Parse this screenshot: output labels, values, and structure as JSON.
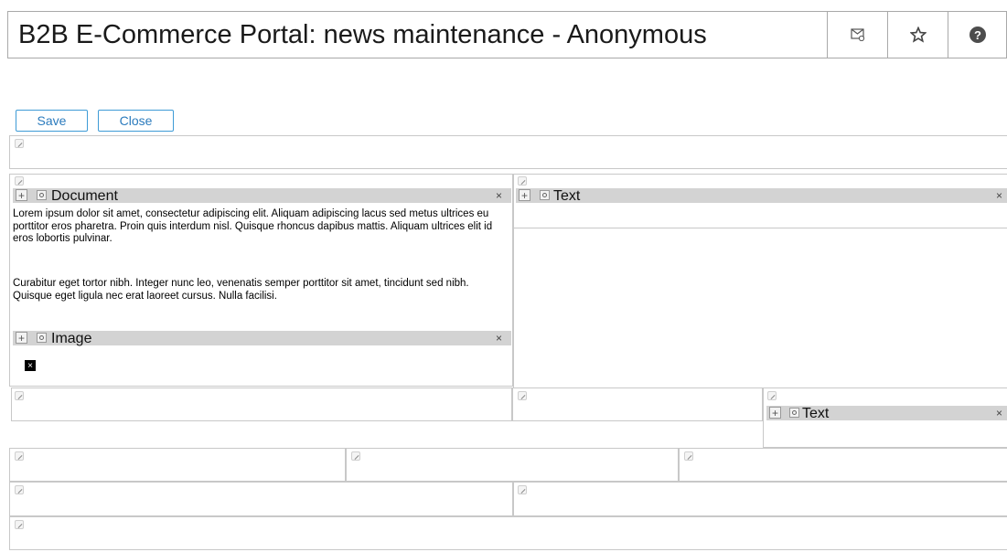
{
  "header": {
    "title": "B2B E-Commerce Portal: news maintenance - Anonymous",
    "icons": [
      "mail-icon",
      "star-icon",
      "help-icon"
    ],
    "help_glyph": "?",
    "star_glyph": "☆",
    "mail_glyph": "✉"
  },
  "actions": {
    "save_label": "Save",
    "close_label": "Close"
  },
  "components": {
    "document": {
      "label": "Document",
      "paragraph1": "Lorem ipsum dolor sit amet, consectetur adipiscing elit. Aliquam adipiscing lacus sed metus ultrices eu porttitor eros pharetra. Proin quis interdum nisl. Quisque rhoncus dapibus mattis. Aliquam ultrices elit id eros lobortis pulvinar.",
      "paragraph2": "Curabitur eget tortor nibh. Integer nunc leo, venenatis semper porttitor sit amet, tincidunt sed nibh. Quisque eget ligula nec erat laoreet cursus. Nulla facilisi."
    },
    "image": {
      "label": "Image"
    },
    "text1": {
      "label": "Text"
    },
    "text2": {
      "label": "Text"
    }
  },
  "glyphs": {
    "plus": "+",
    "close": "×",
    "broken_image": "×"
  },
  "colors": {
    "accent": "#3e9bd6",
    "bar": "#d3d3d3",
    "border": "#c8c8c8"
  }
}
